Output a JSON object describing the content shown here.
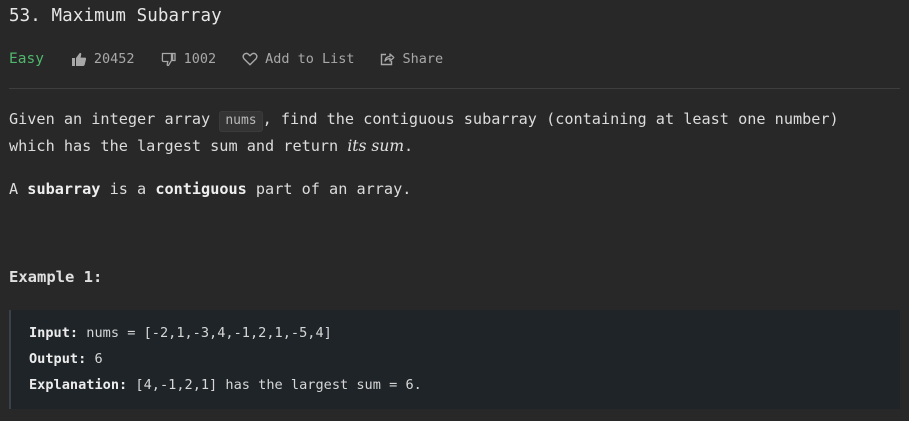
{
  "problem": {
    "title": "53. Maximum Subarray",
    "difficulty": "Easy",
    "likes": "20452",
    "dislikes": "1002",
    "add_to_list_label": "Add to List",
    "share_label": "Share"
  },
  "description": {
    "p1_before_code": "Given an integer array ",
    "code_nums": "nums",
    "p1_after_code": ", find the contiguous subarray (containing at least one number)",
    "p1_line2_text": "which has the largest sum and return ",
    "p1_emphasis": "its sum",
    "p1_end": ".",
    "p2_prefix": "A ",
    "p2_bold1": "subarray",
    "p2_mid": " is a ",
    "p2_bold2": "contiguous",
    "p2_suffix": " part of an array."
  },
  "example1": {
    "heading": "Example 1:",
    "input_label": "Input:",
    "input_value": " nums = [-2,1,-3,4,-1,2,1,-5,4]",
    "output_label": "Output:",
    "output_value": " 6",
    "explanation_label": "Explanation:",
    "explanation_value": " [4,-1,2,1] has the largest sum = 6."
  },
  "colors": {
    "background": "#282828",
    "easy_green": "#4fb86d",
    "example_bg": "#1e2428"
  },
  "icons": [
    "thumbs-up-icon",
    "thumbs-down-icon",
    "heart-icon",
    "share-icon"
  ]
}
